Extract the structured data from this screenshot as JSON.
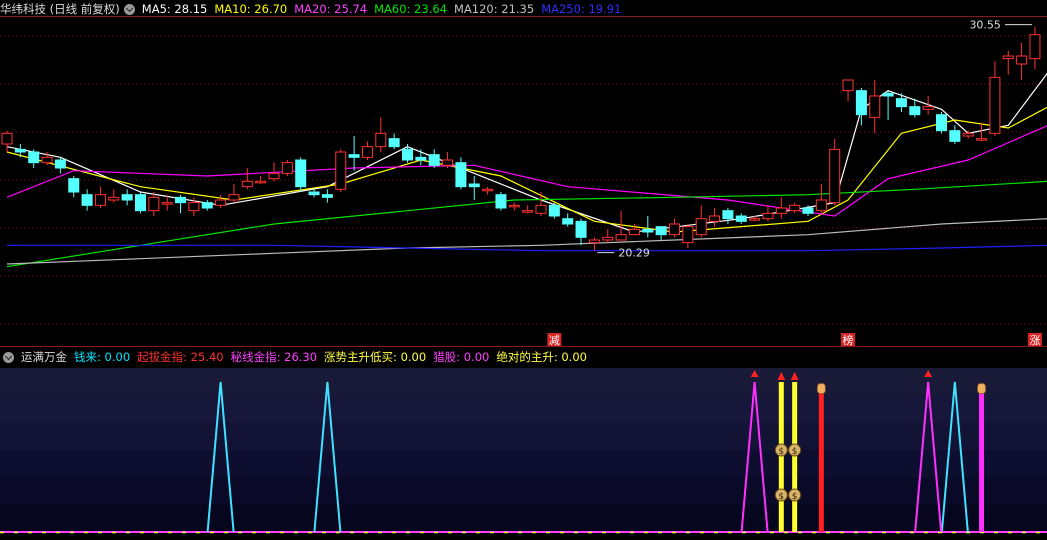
{
  "main_header": {
    "title": "华纬科技 (日线 前复权)",
    "ma5": "MA5: 28.15",
    "ma10": "MA10: 26.70",
    "ma20": "MA20: 25.74",
    "ma60": "MA60: 23.64",
    "ma120": "MA120: 21.35",
    "ma250": "MA250: 19.91"
  },
  "annotations": {
    "high_label": "30.55",
    "low_label": "20.29",
    "markers": [
      {
        "text": "减",
        "index": 41
      },
      {
        "text": "榜",
        "index": 63
      },
      {
        "text": "涨",
        "index": 77
      }
    ]
  },
  "sub_header": {
    "title": "运满万金",
    "items": [
      {
        "text": "钱来: 0.00",
        "color": "#00e5ff"
      },
      {
        "text": "起拔金指: 25.40",
        "color": "#ff3030"
      },
      {
        "text": "秘线金指: 26.30",
        "color": "#ff40ff"
      },
      {
        "text": "涨势主升低买: 0.00",
        "color": "#ffff40"
      },
      {
        "text": "猎股: 0.00",
        "color": "#ff40ff"
      },
      {
        "text": "绝对的主升: 0.00",
        "color": "#ffff40"
      }
    ]
  },
  "colors": {
    "up": "#ff3232",
    "down": "#54ffff",
    "ma5": "#ffffff",
    "ma10": "#ffff00",
    "ma20": "#ff00ff",
    "ma60": "#00e600",
    "ma120": "#bbbbbb",
    "ma250": "#2020ff",
    "grid": "#7a1010"
  },
  "chart_data": {
    "type": "candlestick",
    "y_range": [
      19,
      31
    ],
    "candles": [
      [
        26.2,
        26.6,
        26.7,
        25.9
      ],
      [
        26.0,
        25.9,
        26.2,
        25.7
      ],
      [
        25.9,
        25.5,
        26.0,
        25.3
      ],
      [
        25.5,
        25.7,
        25.9,
        25.4
      ],
      [
        25.6,
        25.3,
        25.7,
        25.1
      ],
      [
        24.9,
        24.4,
        25.0,
        24.2
      ],
      [
        24.3,
        23.9,
        24.5,
        23.7
      ],
      [
        23.9,
        24.3,
        24.6,
        23.8
      ],
      [
        24.1,
        24.2,
        24.5,
        24.0
      ],
      [
        24.3,
        24.1,
        24.5,
        23.9
      ],
      [
        24.3,
        23.7,
        24.4,
        23.6
      ],
      [
        23.7,
        24.2,
        24.4,
        23.5
      ],
      [
        24.0,
        24.0,
        24.3,
        23.7
      ],
      [
        24.2,
        24.0,
        24.3,
        23.6
      ],
      [
        23.7,
        24.0,
        24.2,
        23.5
      ],
      [
        24.0,
        23.8,
        24.1,
        23.7
      ],
      [
        23.9,
        24.1,
        24.3,
        23.8
      ],
      [
        24.1,
        24.3,
        24.7,
        24.0
      ],
      [
        24.6,
        24.8,
        25.3,
        24.5
      ],
      [
        24.8,
        24.8,
        25.0,
        24.7
      ],
      [
        24.9,
        25.1,
        25.5,
        24.8
      ],
      [
        25.1,
        25.5,
        25.6,
        25.0
      ],
      [
        25.6,
        24.6,
        25.7,
        24.4
      ],
      [
        24.4,
        24.3,
        24.5,
        24.2
      ],
      [
        24.3,
        24.2,
        24.5,
        24.0
      ],
      [
        24.5,
        25.9,
        26.0,
        24.4
      ],
      [
        25.8,
        25.7,
        26.5,
        25.2
      ],
      [
        25.7,
        26.1,
        26.3,
        25.6
      ],
      [
        26.1,
        26.6,
        27.2,
        25.9
      ],
      [
        26.4,
        26.1,
        26.6,
        26.0
      ],
      [
        26.0,
        25.6,
        26.2,
        25.5
      ],
      [
        25.7,
        25.6,
        26.0,
        25.4
      ],
      [
        25.8,
        25.4,
        26.0,
        25.3
      ],
      [
        25.4,
        25.6,
        25.9,
        25.3
      ],
      [
        25.5,
        24.6,
        25.7,
        24.5
      ],
      [
        24.7,
        24.6,
        25.0,
        24.1
      ],
      [
        24.5,
        24.5,
        24.6,
        24.3
      ],
      [
        24.3,
        23.8,
        24.4,
        23.7
      ],
      [
        23.9,
        23.9,
        24.0,
        23.7
      ],
      [
        23.7,
        23.7,
        23.9,
        23.6
      ],
      [
        23.6,
        23.9,
        24.4,
        23.5
      ],
      [
        23.9,
        23.5,
        24.0,
        23.4
      ],
      [
        23.4,
        23.2,
        23.6,
        23.1
      ],
      [
        23.3,
        22.7,
        23.4,
        22.4
      ],
      [
        22.5,
        22.6,
        22.7,
        22.2
      ],
      [
        22.6,
        22.7,
        23.0,
        22.5
      ],
      [
        22.6,
        22.8,
        23.7,
        22.6
      ],
      [
        22.8,
        23.0,
        23.2,
        22.8
      ],
      [
        23.0,
        22.9,
        23.5,
        22.7
      ],
      [
        23.1,
        22.8,
        23.1,
        22.6
      ],
      [
        22.8,
        23.2,
        23.4,
        22.7
      ],
      [
        22.5,
        23.1,
        23.2,
        22.3
      ],
      [
        22.8,
        23.4,
        23.9,
        22.7
      ],
      [
        23.3,
        23.5,
        23.8,
        23.1
      ],
      [
        23.7,
        23.4,
        23.8,
        23.2
      ],
      [
        23.5,
        23.3,
        23.6,
        23.2
      ],
      [
        23.4,
        23.4,
        23.5,
        23.3
      ],
      [
        23.4,
        23.6,
        23.9,
        23.3
      ],
      [
        23.6,
        23.8,
        24.2,
        23.4
      ],
      [
        23.7,
        23.9,
        24.0,
        23.6
      ],
      [
        23.8,
        23.6,
        23.9,
        23.5
      ],
      [
        23.7,
        24.1,
        24.7,
        23.6
      ],
      [
        24.0,
        26.0,
        26.4,
        23.9
      ],
      [
        28.2,
        28.6,
        28.6,
        27.8
      ],
      [
        28.2,
        27.3,
        28.3,
        26.9
      ],
      [
        27.2,
        28.0,
        28.6,
        26.6
      ],
      [
        28.1,
        28.0,
        28.2,
        27.1
      ],
      [
        27.9,
        27.6,
        28.1,
        27.4
      ],
      [
        27.6,
        27.3,
        27.9,
        27.2
      ],
      [
        27.5,
        27.6,
        28.0,
        27.3
      ],
      [
        27.3,
        26.7,
        27.4,
        26.6
      ],
      [
        26.7,
        26.3,
        26.9,
        26.2
      ],
      [
        26.5,
        26.6,
        26.7,
        26.4
      ],
      [
        26.4,
        26.4,
        27.0,
        26.3
      ],
      [
        26.6,
        28.7,
        29.3,
        26.5
      ],
      [
        29.4,
        29.5,
        29.7,
        28.8
      ],
      [
        29.2,
        29.5,
        30.0,
        28.6
      ],
      [
        29.4,
        30.3,
        30.6,
        29.0
      ]
    ],
    "ma": {
      "MA5": [
        [
          0,
          26.1
        ],
        [
          4,
          25.7
        ],
        [
          10,
          24.4
        ],
        [
          16,
          23.9
        ],
        [
          24,
          24.6
        ],
        [
          30,
          26.1
        ],
        [
          40,
          24.1
        ],
        [
          47,
          22.9
        ],
        [
          55,
          23.4
        ],
        [
          62,
          24.0
        ],
        [
          64,
          27.5
        ],
        [
          66,
          28.2
        ],
        [
          70,
          27.5
        ],
        [
          72,
          26.6
        ],
        [
          75,
          26.9
        ],
        [
          78,
          28.9
        ]
      ],
      "MA10": [
        [
          0,
          25.9
        ],
        [
          10,
          24.6
        ],
        [
          17,
          24.1
        ],
        [
          25,
          24.7
        ],
        [
          31,
          25.6
        ],
        [
          37,
          25.0
        ],
        [
          44,
          23.3
        ],
        [
          50,
          22.9
        ],
        [
          60,
          23.3
        ],
        [
          63,
          24.1
        ],
        [
          67,
          26.6
        ],
        [
          71,
          27.1
        ],
        [
          75,
          26.8
        ],
        [
          78,
          27.6
        ]
      ],
      "MA20": [
        [
          0,
          24.2
        ],
        [
          5,
          25.2
        ],
        [
          15,
          25.0
        ],
        [
          26,
          25.3
        ],
        [
          35,
          25.4
        ],
        [
          42,
          24.6
        ],
        [
          54,
          24.1
        ],
        [
          62,
          23.5
        ],
        [
          66,
          24.9
        ],
        [
          72,
          25.6
        ],
        [
          78,
          26.9
        ]
      ],
      "MA60": [
        [
          0,
          21.6
        ],
        [
          10,
          22.4
        ],
        [
          20,
          23.2
        ],
        [
          30,
          23.7
        ],
        [
          38,
          24.1
        ],
        [
          50,
          24.2
        ],
        [
          60,
          24.3
        ],
        [
          68,
          24.5
        ],
        [
          78,
          24.8
        ]
      ],
      "MA120": [
        [
          0,
          21.7
        ],
        [
          10,
          21.9
        ],
        [
          20,
          22.1
        ],
        [
          30,
          22.3
        ],
        [
          40,
          22.4
        ],
        [
          50,
          22.6
        ],
        [
          60,
          22.8
        ],
        [
          70,
          23.2
        ],
        [
          78,
          23.4
        ]
      ],
      "MA250": [
        [
          0,
          22.4
        ],
        [
          20,
          22.4
        ],
        [
          40,
          22.2
        ],
        [
          60,
          22.2
        ],
        [
          70,
          22.3
        ],
        [
          78,
          22.4
        ]
      ]
    },
    "sub_signals": {
      "y_range": [
        0,
        1
      ],
      "cyan_spikes": [
        16,
        24,
        71
      ],
      "magenta_spikes": [
        56,
        69
      ],
      "yellow_bars": [
        58,
        59
      ],
      "red_bars": [
        61
      ],
      "magenta_bars": [
        73
      ]
    }
  }
}
